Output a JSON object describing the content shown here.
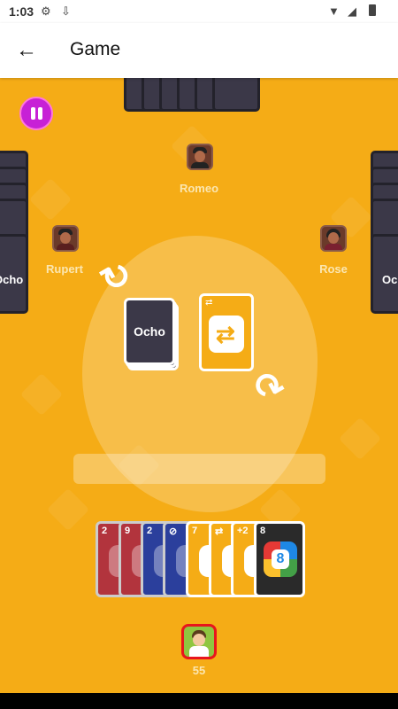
{
  "status": {
    "time": "1:03"
  },
  "appbar": {
    "title": "Game",
    "back_icon": "←"
  },
  "players": {
    "top": {
      "name": "Romeo"
    },
    "left": {
      "name": "Rupert"
    },
    "right": {
      "name": "Rose"
    },
    "me": {
      "score": "55"
    }
  },
  "deck": {
    "brand": "Ocho"
  },
  "hand": [
    {
      "label": "2",
      "color": "#b2343d"
    },
    {
      "label": "9",
      "color": "#b2343d"
    },
    {
      "label": "2",
      "color": "#2b3f9c"
    },
    {
      "label": "⊘",
      "color": "#2b3f9c"
    },
    {
      "label": "7",
      "color": "#f5ac16"
    },
    {
      "label": "⇄",
      "color": "#f5ac16"
    },
    {
      "label": "+2",
      "color": "#f5ac16"
    },
    {
      "label": "8",
      "color": "#2a2a2a"
    }
  ],
  "colors": {
    "table": "#f5ac16",
    "pause": "#c721d6",
    "card_back": "#3b3848",
    "accent_red": "#e8151c"
  }
}
